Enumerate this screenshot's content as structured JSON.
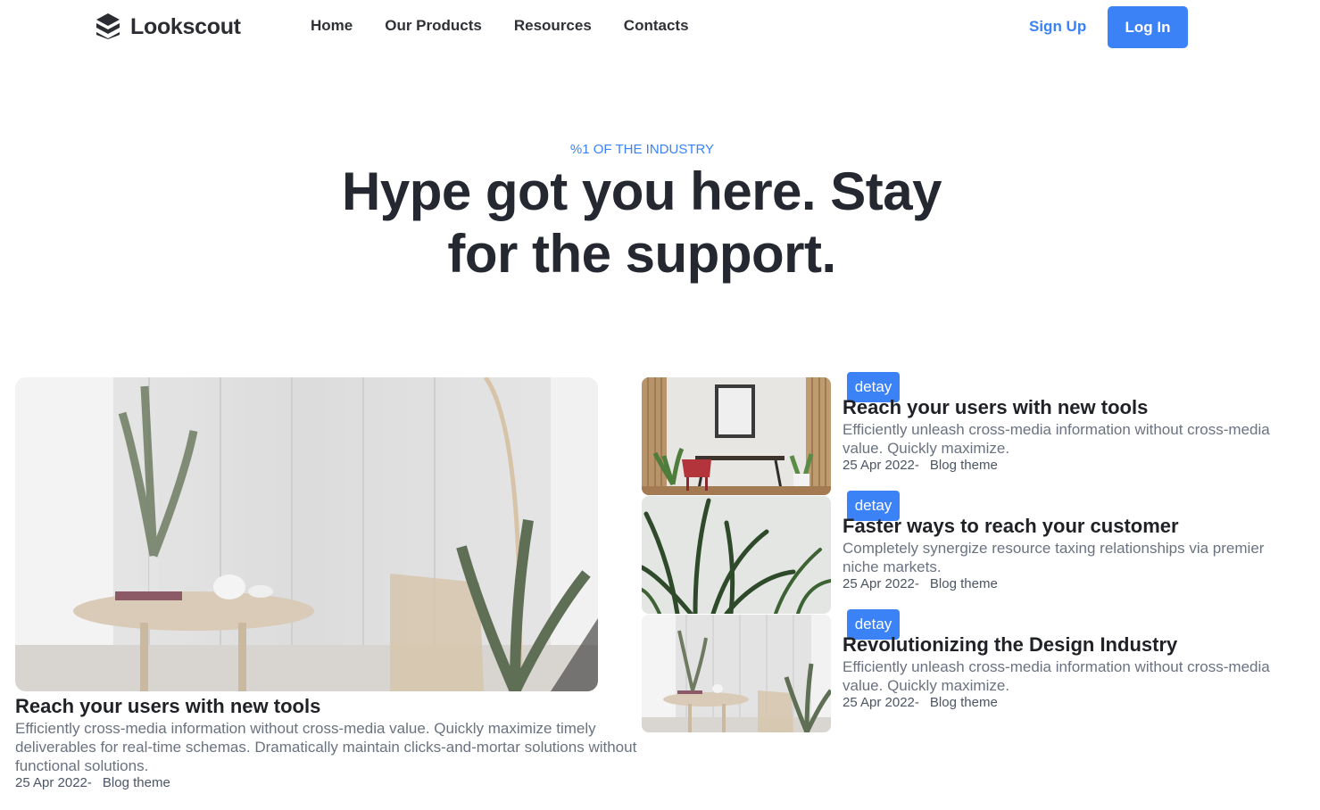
{
  "header": {
    "brand": "Lookscout",
    "nav": [
      "Home",
      "Our Products",
      "Resources",
      "Contacts"
    ],
    "sign_up": "Sign Up",
    "log_in": "Log In",
    "accent": "#3b82f6"
  },
  "hero": {
    "eyebrow": "%1 OF THE INDUSTRY",
    "headline": "Hype got you here. Stay for the support."
  },
  "featured": {
    "title": "Reach your users with new tools",
    "description": "Efficiently cross-media information without cross-media value. Quickly maximize timely deliverables for real-time schemas. Dramatically maintain clicks-and-mortar solutions without functional solutions.",
    "date": "25 Apr 2022-",
    "category": "Blog theme"
  },
  "posts": [
    {
      "tag": "detay",
      "title": "Reach your users with new tools",
      "description": "Efficiently unleash cross-media information without cross-media value. Quickly maximize.",
      "date": "25 Apr 2022-",
      "category": "Blog theme"
    },
    {
      "tag": "detay",
      "title": "Faster ways to reach your customer",
      "description": "Completely synergize resource taxing relationships via premier niche markets.",
      "date": "25 Apr 2022-",
      "category": "Blog theme"
    },
    {
      "tag": "detay",
      "title": "Revolutionizing the Design Industry",
      "description": "Efficiently unleash cross-media information without cross-media value. Quickly maximize.",
      "date": "25 Apr 2022-",
      "category": "Blog theme"
    }
  ]
}
